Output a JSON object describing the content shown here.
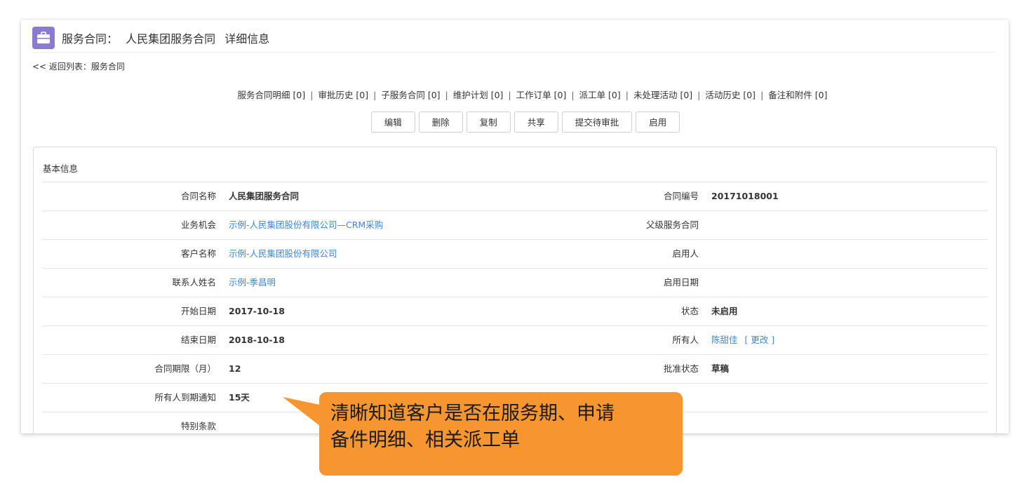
{
  "header": {
    "module": "服务合同：",
    "record_name": "人民集团服务合同",
    "suffix": "详细信息"
  },
  "back_link": "<< 返回列表：服务合同",
  "related": [
    "服务合同明细 [0]",
    "审批历史 [0]",
    "子服务合同 [0]",
    "维护计划 [0]",
    "工作订单 [0]",
    "派工单 [0]",
    "未处理活动 [0]",
    "活动历史 [0]",
    "备注和附件 [0]"
  ],
  "separator": "|",
  "buttons": {
    "edit": "编辑",
    "delete": "删除",
    "copy": "复制",
    "share": "共享",
    "submit": "提交待审批",
    "enable": "启用"
  },
  "panel": {
    "title": "基本信息",
    "rows": [
      {
        "l1": "合同名称",
        "v1": "人民集团服务合同",
        "l2": "合同编号",
        "v2": "20171018001"
      },
      {
        "l1": "业务机会",
        "v1": "示例-人民集团股份有限公司—CRM采购",
        "l2": "父级服务合同",
        "v2": ""
      },
      {
        "l1": "客户名称",
        "v1": "示例-人民集团股份有限公司",
        "l2": "启用人",
        "v2": ""
      },
      {
        "l1": "联系人姓名",
        "v1": "示例-季昌明",
        "l2": "启用日期",
        "v2": ""
      },
      {
        "l1": "开始日期",
        "v1": "2017-10-18",
        "l2": "状态",
        "v2": "未启用"
      },
      {
        "l1": "结束日期",
        "v1": "2018-10-18",
        "l2": "所有人",
        "v2": "陈甜佳",
        "v2_extra": "[ 更改 ]"
      },
      {
        "l1": "合同期限（月）",
        "v1": "12",
        "l2": "批准状态",
        "v2": "草稿"
      },
      {
        "l1": "所有人到期通知",
        "v1": "15天",
        "l2": "",
        "v2": ""
      },
      {
        "l1": "特别条款",
        "v1": "",
        "l2": "",
        "v2": ""
      }
    ]
  },
  "callout": {
    "text": "清晰知道客户是否在服务期、申请\n备件明细、相关派工单"
  },
  "colors": {
    "accent": "#8a7bcc",
    "link": "#3e87d6",
    "callout": "#f7962f"
  }
}
